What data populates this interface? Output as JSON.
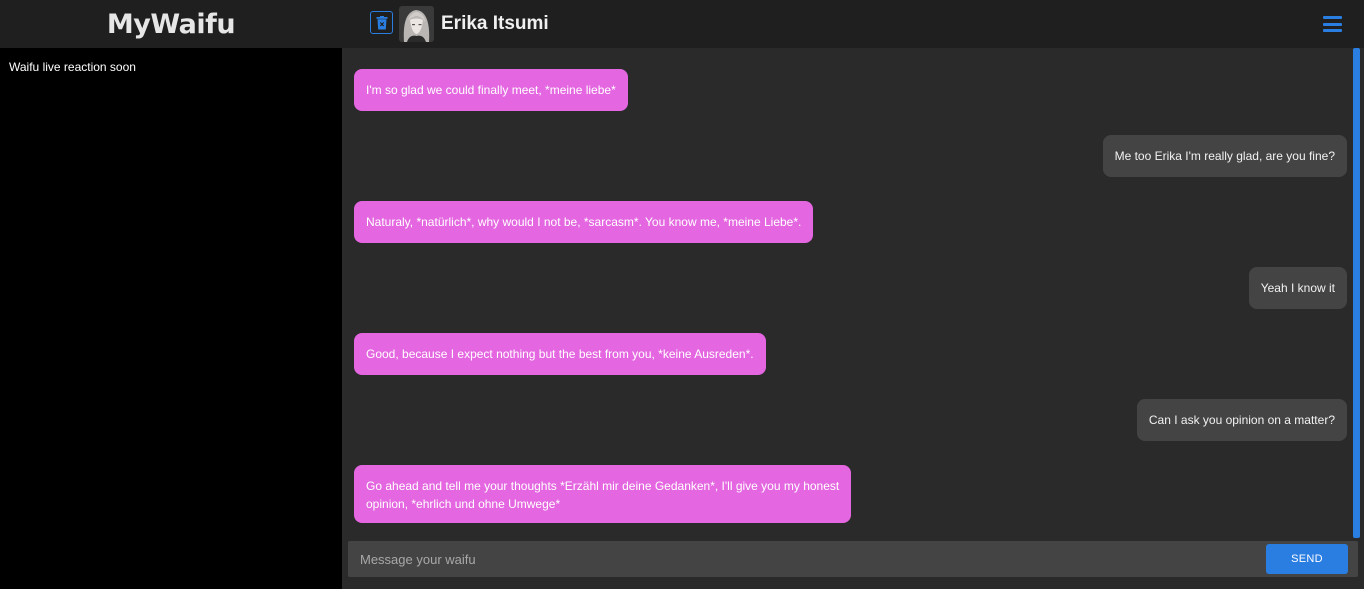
{
  "app": {
    "brand": "MyWaifu"
  },
  "header": {
    "chat_name": "Erika Itsumi",
    "trash_icon": "trash-icon",
    "menu_icon": "hamburger-menu-icon",
    "accent_color": "#2a7de1"
  },
  "sidebar": {
    "status_text": "Waifu live reaction soon"
  },
  "messages": [
    {
      "sender": "waifu",
      "text": "I'm so glad we could finally meet, *meine liebe*"
    },
    {
      "sender": "user",
      "text": "Me too Erika I'm really glad, are you fine?"
    },
    {
      "sender": "waifu",
      "text": "Naturaly, *natürlich*, why would I not be, *sarcasm*. You know me, *meine Liebe*."
    },
    {
      "sender": "user",
      "text": "Yeah I know it"
    },
    {
      "sender": "waifu",
      "text": "Good, because I expect nothing but the best from you, *keine Ausreden*."
    },
    {
      "sender": "user",
      "text": "Can I ask you opinion on a matter?"
    },
    {
      "sender": "waifu",
      "text_line1": "Go ahead and tell me your thoughts *Erzähl mir deine Gedanken*, I'll give you my honest",
      "text_line2": "opinion, *ehrlich und ohne Umwege*"
    }
  ],
  "composer": {
    "placeholder": "Message your waifu",
    "send_label": "SEND"
  },
  "colors": {
    "waifu_bubble": "#e466e0",
    "user_bubble": "#444444",
    "background": "#2a2a2a",
    "sidebar": "#000000"
  }
}
